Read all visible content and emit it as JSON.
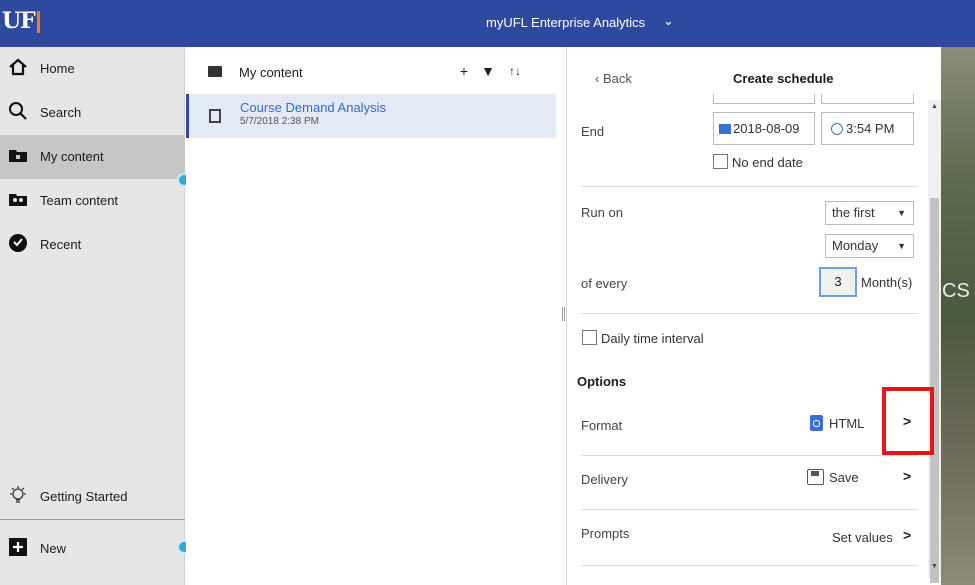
{
  "header": {
    "logo": "UF",
    "app_title": "myUFL Enterprise Analytics",
    "chevron": "⌄"
  },
  "nav": {
    "items": [
      {
        "label": "Home",
        "icon": "home-icon"
      },
      {
        "label": "Search",
        "icon": "search-icon"
      },
      {
        "label": "My content",
        "icon": "folder-icon",
        "active": true
      },
      {
        "label": "Team content",
        "icon": "team-folder-icon"
      },
      {
        "label": "Recent",
        "icon": "clock-icon"
      }
    ],
    "getting_started": "Getting Started",
    "new_label": "New"
  },
  "content": {
    "title": "My content",
    "add": "+",
    "filter": "▼",
    "sort": "↑↓",
    "items": [
      {
        "title": "Course Demand Analysis",
        "date": "5/7/2018 2:38 PM"
      }
    ]
  },
  "schedule": {
    "back": "Back",
    "title": "Create schedule",
    "end_label": "End",
    "end_date": "2018-08-09",
    "end_time": "3:54 PM",
    "no_end_date": "No end date",
    "run_on_label": "Run on",
    "run_on_value": "the first",
    "day_value": "Monday",
    "of_every_label": "of every",
    "interval": "3",
    "interval_unit": "Month(s)",
    "daily_interval": "Daily time interval",
    "options_heading": "Options",
    "format_label": "Format",
    "format_value": "HTML",
    "delivery_label": "Delivery",
    "delivery_value": "Save",
    "prompts_label": "Prompts",
    "prompts_value": "Set values",
    "chevron": ">"
  },
  "background_text": "CS",
  "colors": {
    "header": "#2e4a9e",
    "accent": "#2e6bd1",
    "highlight": "#e8141b"
  }
}
